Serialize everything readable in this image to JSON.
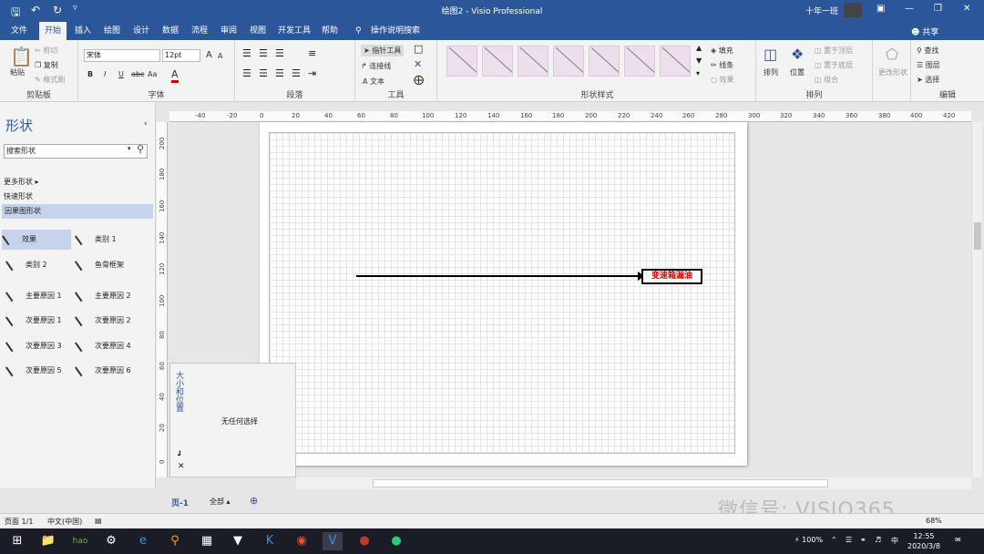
{
  "app": {
    "title": "绘图2 - Visio Professional",
    "user_name": "十年一班",
    "quick_access": {
      "save_icon": "save-icon",
      "undo_icon": "undo-icon",
      "redo_icon": "redo-icon"
    },
    "window_controls": [
      "ribbon-display-icon",
      "minimize-icon",
      "restore-icon",
      "close-icon"
    ]
  },
  "menu": {
    "tabs": [
      "文件",
      "开始",
      "插入",
      "绘图",
      "设计",
      "数据",
      "流程",
      "审阅",
      "视图",
      "开发工具",
      "帮助"
    ],
    "active_tab": "开始",
    "tell_me": "操作说明搜索",
    "share": "共享"
  },
  "ribbon": {
    "clipboard": {
      "paste": "粘贴",
      "cut": "剪切",
      "copy": "复制",
      "format_painter": "格式刷",
      "label": "剪贴板"
    },
    "font": {
      "font_name": "宋体",
      "font_size": "12pt",
      "bold": "B",
      "italic": "I",
      "underline": "U",
      "strike": "abc",
      "case": "Aa",
      "color": "A",
      "grow": "A",
      "shrink": "A",
      "label": "字体"
    },
    "paragraph": {
      "label": "段落"
    },
    "tools": {
      "pointer": "指针工具",
      "connector": "连接线",
      "text": "文本",
      "label": "工具"
    },
    "shape_styles": {
      "label": "形状样式",
      "fill": "填充",
      "line": "线条",
      "effects": "效果"
    },
    "arrange": {
      "arrange": "排列",
      "position": "位置",
      "bring_front": "置于顶层",
      "send_back": "置于底层",
      "group": "组合",
      "label": "排列"
    },
    "change_shape": "更改形状",
    "editing": {
      "find": "查找",
      "layers": "图层",
      "select": "选择",
      "label": "编辑"
    }
  },
  "shapes_pane": {
    "title": "形状",
    "search_placeholder": "搜索形状",
    "more_shapes": "更多形状",
    "quick_shapes": "快速形状",
    "stencil": "因果图形状",
    "items": [
      {
        "label": "效果",
        "icon": "effect-shape-icon"
      },
      {
        "label": "类别 1",
        "icon": "category-shape-icon"
      },
      {
        "label": "类别 2",
        "icon": "category-shape-icon"
      },
      {
        "label": "鱼骨框架",
        "icon": "fishbone-frame-icon"
      },
      {
        "label": "主要原因 1",
        "icon": "primary-cause-icon"
      },
      {
        "label": "主要原因 2",
        "icon": "primary-cause-icon"
      },
      {
        "label": "次要原因 1",
        "icon": "secondary-cause-icon"
      },
      {
        "label": "次要原因 2",
        "icon": "secondary-cause-icon"
      },
      {
        "label": "次要原因 3",
        "icon": "secondary-cause-icon"
      },
      {
        "label": "次要原因 4",
        "icon": "secondary-cause-icon"
      },
      {
        "label": "次要原因 5",
        "icon": "secondary-cause-icon"
      },
      {
        "label": "次要原因 6",
        "icon": "secondary-cause-icon"
      }
    ]
  },
  "size_panel": {
    "title": "大小和位置",
    "message": "无任何选择"
  },
  "rulers": {
    "horizontal": [
      "-40",
      "-20",
      "0",
      "20",
      "40",
      "60",
      "80",
      "100",
      "120",
      "140",
      "160",
      "180",
      "200",
      "220",
      "240",
      "260",
      "280",
      "300",
      "320",
      "340",
      "360",
      "380",
      "400",
      "420"
    ],
    "vertical": [
      "200",
      "180",
      "160",
      "140",
      "120",
      "100",
      "80",
      "60",
      "40",
      "20",
      "0"
    ]
  },
  "diagram": {
    "effect_text": "变速箱漏油"
  },
  "page_tabs": {
    "current": "页-1",
    "all": "全部"
  },
  "status": {
    "page": "页面 1/1",
    "language": "中文(中国)",
    "zoom": "68%"
  },
  "watermark": "微信号: VISIO365",
  "taskbar": {
    "apps": [
      "windows-start-icon",
      "file-explorer-icon",
      "hao123-icon",
      "settings-icon",
      "ie-icon",
      "search-app-icon",
      "calculator-icon",
      "app-icon",
      "k-app-icon",
      "chrome-icon",
      "visio-icon",
      "game-icon",
      "wechat-icon"
    ],
    "battery": "100%",
    "ime": "中",
    "time": "12:55",
    "date": "2020/3/8"
  }
}
